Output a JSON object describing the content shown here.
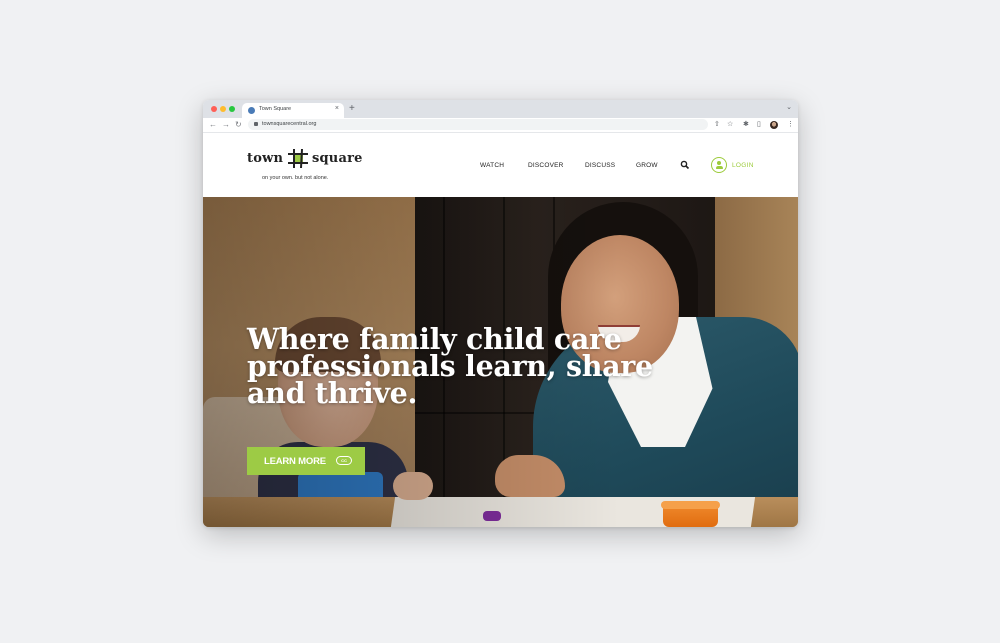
{
  "browser": {
    "tab": {
      "title": "Town Square",
      "favicon": "globe-favicon-icon",
      "close_label": "×"
    },
    "new_tab_label": "+",
    "tab_menu_icon": "chevron-down-icon",
    "toolbar": {
      "back_icon": "←",
      "forward_icon": "→",
      "reload_icon": "↻",
      "url": "townsquarecentral.org",
      "share_icon": "⇧",
      "bookmark_icon": "☆",
      "extensions_icon": "✱",
      "sidepanel_icon": "▯",
      "menu_icon": "⋮"
    }
  },
  "site": {
    "logo": {
      "word_left": "town",
      "word_right": "square",
      "tagline": "on your own. but not alone."
    },
    "nav": [
      {
        "label": "WATCH"
      },
      {
        "label": "DISCOVER"
      },
      {
        "label": "DISCUSS"
      },
      {
        "label": "GROW"
      }
    ],
    "login_label": "LOGIN",
    "colors": {
      "accent": "#9dcb45",
      "text": "#222222"
    }
  },
  "hero": {
    "title_lines": [
      "Where family child care",
      "professionals learn, share",
      "and thrive."
    ],
    "cta_label": "LEARN MORE",
    "cta_badge": "CC"
  }
}
